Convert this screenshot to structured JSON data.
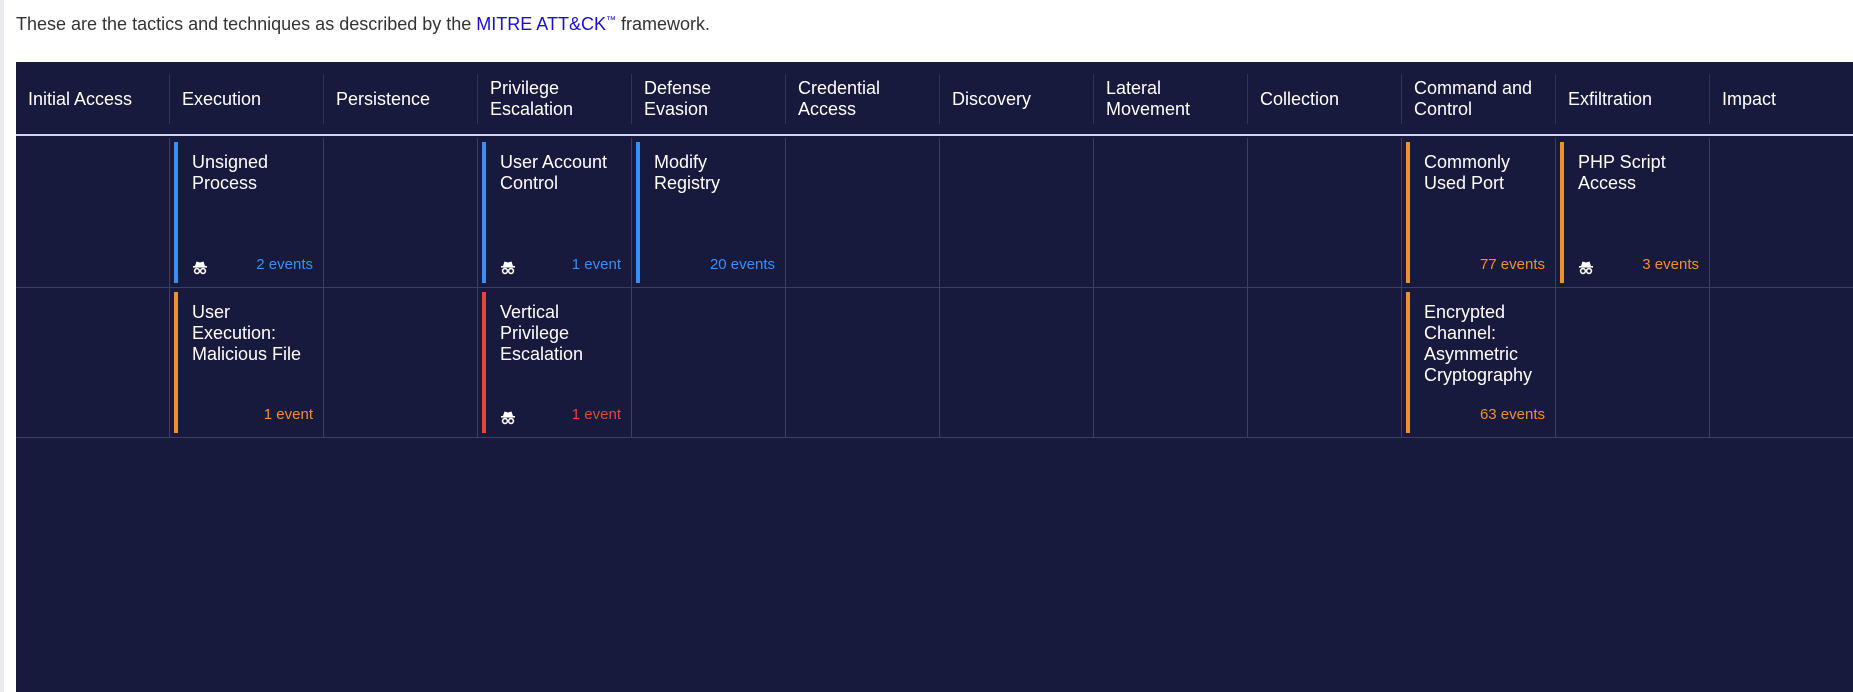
{
  "intro": {
    "prefix": "These are the tactics and techniques as described by the",
    "link": "MITRE ATT&CK",
    "trademark": "™",
    "suffix": "framework."
  },
  "tactics": [
    "Initial Access",
    "Execution",
    "Persistence",
    "Privilege Escalation",
    "Defense Evasion",
    "Credential Access",
    "Discovery",
    "Lateral Movement",
    "Collection",
    "Command and Control",
    "Exfiltration",
    "Impact"
  ],
  "techniques": {
    "unsigned_process": {
      "name": "Unsigned Process",
      "events": "2 events",
      "color": "#3b8ef5",
      "icon": "spy-icon"
    },
    "user_account_control": {
      "name": "User Account Control",
      "events": "1 event",
      "color": "#3b8ef5",
      "icon": "spy-icon"
    },
    "modify_registry": {
      "name": "Modify Registry",
      "events": "20 events",
      "color": "#3b8ef5"
    },
    "commonly_used_port": {
      "name": "Commonly Used Port",
      "events": "77 events",
      "color": "#f0902e"
    },
    "php_script_access": {
      "name": "PHP Script Access",
      "events": "3 events",
      "color": "#f0902e",
      "icon": "spy-icon"
    },
    "user_execution": {
      "name": "User Execution: Malicious File",
      "events": "1 event",
      "color": "#f0902e"
    },
    "vertical_privilege_escalation": {
      "name": "Vertical Privilege Escalation",
      "events": "1 event",
      "color": "#e0473a",
      "icon": "spy-icon"
    },
    "encrypted_channel": {
      "name": "Encrypted Channel: Asymmetric Cryptography",
      "events": "63 events",
      "color": "#f0902e"
    }
  },
  "colors": {
    "board_background": "#171a3d",
    "severity_low": "#3b8ef5",
    "severity_medium": "#f0902e",
    "severity_high": "#e0473a",
    "link": "#1a0dd9"
  }
}
